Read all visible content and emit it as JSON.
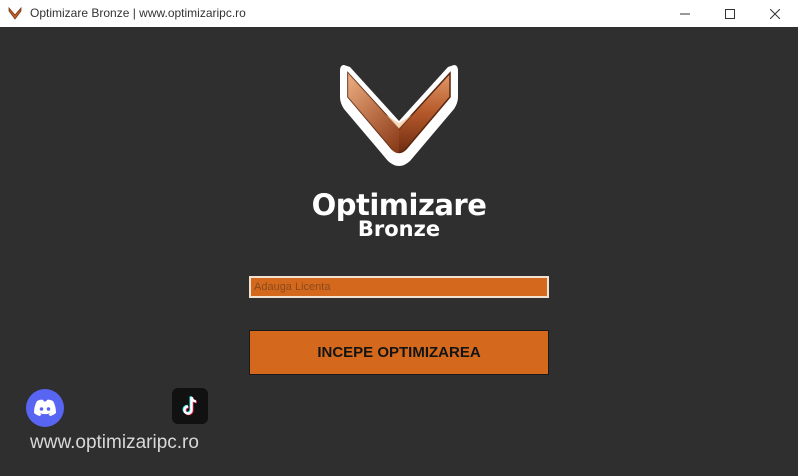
{
  "window": {
    "title": "Optimizare Bronze | www.optimizaripc.ro",
    "app_icon": "bronze-v-logo-icon",
    "controls": [
      "minimize-icon",
      "maximize-icon",
      "close-icon"
    ]
  },
  "brand": {
    "logo_icon": "bronze-chevron-logo",
    "name_line1": "Optimizare",
    "name_line2": "Bronze"
  },
  "license": {
    "placeholder": "Adauga Licenta",
    "value": ""
  },
  "start_button": {
    "label": "INCEPE OPTIMIZAREA"
  },
  "social": {
    "discord_icon": "discord-icon",
    "tiktok_icon": "tiktok-icon",
    "website": "www.optimizaripc.ro"
  },
  "colors": {
    "background": "#2f2f2f",
    "accent": "#d4691e",
    "text": "#ffffff",
    "discord": "#5865f2"
  }
}
